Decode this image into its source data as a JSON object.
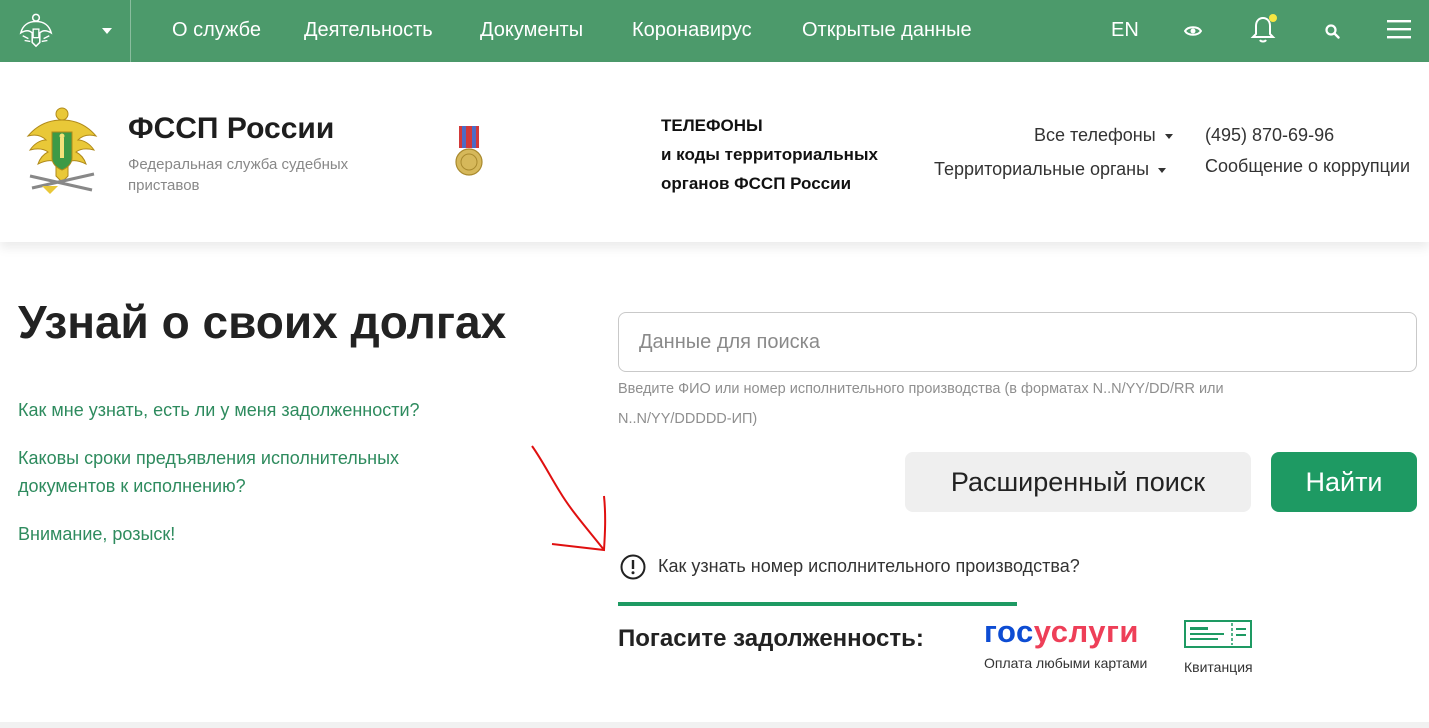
{
  "colors": {
    "nav_green": "#4c9a6b",
    "button_green": "#1e9a63",
    "link_green": "#2e8b5e",
    "gos_blue": "#0d4cd3",
    "gos_red": "#ee3f58",
    "annotation_red": "#e01010"
  },
  "topnav": {
    "links": [
      "О службе",
      "Деятельность",
      "Документы",
      "Коронавирус",
      "Открытые данные"
    ],
    "lang": "EN",
    "icons": [
      "emblem-icon",
      "chevron-down-icon",
      "eye-icon",
      "bell-icon",
      "search-icon",
      "menu-icon"
    ]
  },
  "header": {
    "org_name": "ФССП России",
    "org_sub": "Федеральная служба судебных приставов",
    "phones_title": [
      "ТЕЛЕФОНЫ",
      "и коды территориальных",
      "органов ФССП России"
    ],
    "all_phones": "Все телефоны",
    "territorial": "Территориальные органы",
    "phone": "(495) 870-69-96",
    "corruption": "Сообщение о коррупции"
  },
  "main": {
    "title": "Узнай о своих долгах",
    "faq": [
      "Как мне узнать, есть ли у меня задолженности?",
      "Каковы сроки предъявления исполнительных документов к исполнению?",
      "Внимание, розыск!"
    ],
    "search": {
      "placeholder": "Данные для поиска",
      "hint": "Введите ФИО или номер исполнительного производства (в форматах N..N/YY/DD/RR или N..N/YY/DDDDD-ИП)"
    },
    "advanced_button": "Расширенный поиск",
    "find_button": "Найти",
    "info_link": "Как узнать номер исполнительного производства?",
    "pay": {
      "title": "Погасите задолженность:",
      "gos_part1": "гос",
      "gos_part2": "услуги",
      "gos_caption": "Оплата любыми картами",
      "receipt_caption": "Квитанция"
    }
  }
}
